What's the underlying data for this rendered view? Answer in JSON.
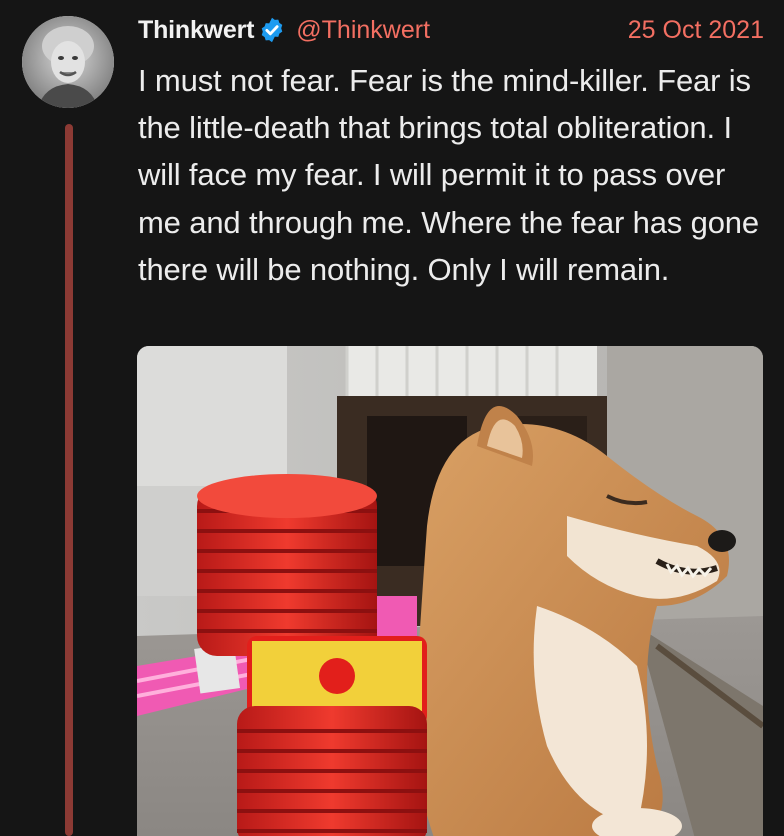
{
  "tweet": {
    "display_name": "Thinkwert",
    "handle": "@Thinkwert",
    "date": "25 Oct 2021",
    "text": "I must not fear. Fear is the mind-killer. Fear is the little-death that brings total obliteration. I will face my fear. I will permit it to pass over me and through me. Where the fear has gone there will be nothing. Only I will remain.",
    "verified": true
  },
  "icons": {
    "verified": "verified-badge-icon",
    "avatar": "profile-photo"
  },
  "colors": {
    "background": "#151515",
    "text": "#ececec",
    "accent": "#f36f62",
    "thread_line": "#8c3a34",
    "verified_badge": "#1d9bf0"
  }
}
